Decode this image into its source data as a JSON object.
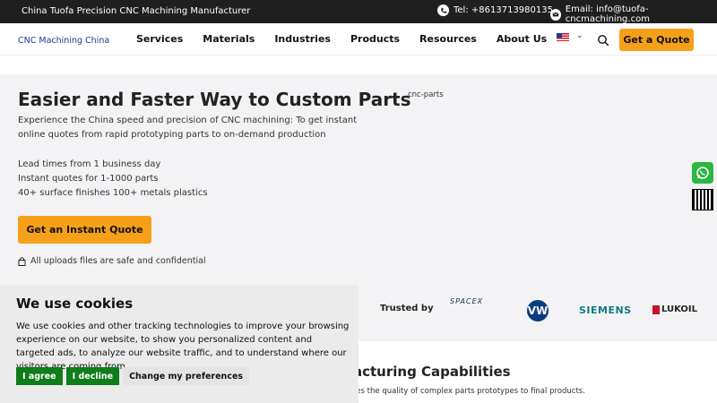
{
  "topbar": {
    "company": "China Tuofa Precision CNC Machining Manufacturer",
    "phone": "Tel: +8613713980135",
    "email": "Email: info@tuofa-cncmachining.com"
  },
  "header": {
    "logo": "CNC Machining China",
    "nav": [
      "Services",
      "Materials",
      "Industries",
      "Products",
      "Resources",
      "About Us"
    ],
    "quote_button": "Get a Quote"
  },
  "hero": {
    "title": "Easier and Faster Way to Custom Parts",
    "intro": "Experience the China speed and precision of CNC machining: To get instant online quotes from rapid prototyping parts to on-demand production",
    "features": [
      "Lead times from 1 business day",
      "Instant quotes for 1-1000 parts",
      "40+ surface finishes 100+ metals plastics"
    ],
    "image_alt": "cnc-parts",
    "cta": "Get an Instant Quote",
    "safe_note": "All uploads files are safe and confidential"
  },
  "trusted": {
    "label": "Trusted by",
    "logos": [
      "SPACEX",
      "VW",
      "SIEMENS",
      "LUKOIL"
    ]
  },
  "capabilities": {
    "title_fragment": "acturing Capabilities",
    "subtitle_fragment": "res the quality of complex parts prototypes to final products."
  },
  "cookie": {
    "title": "We use cookies",
    "text": "We use cookies and other tracking technologies to improve your browsing experience on our website, to show you personalized content and targeted ads, to analyze our website traffic, and to understand where our visitors are coming from.",
    "agree": "I agree",
    "decline": "I decline",
    "preferences": "Change my preferences"
  },
  "colors": {
    "accent": "#f6a01a",
    "topbar": "#1f1f1f",
    "cookie_green": "#0f7d1a"
  }
}
